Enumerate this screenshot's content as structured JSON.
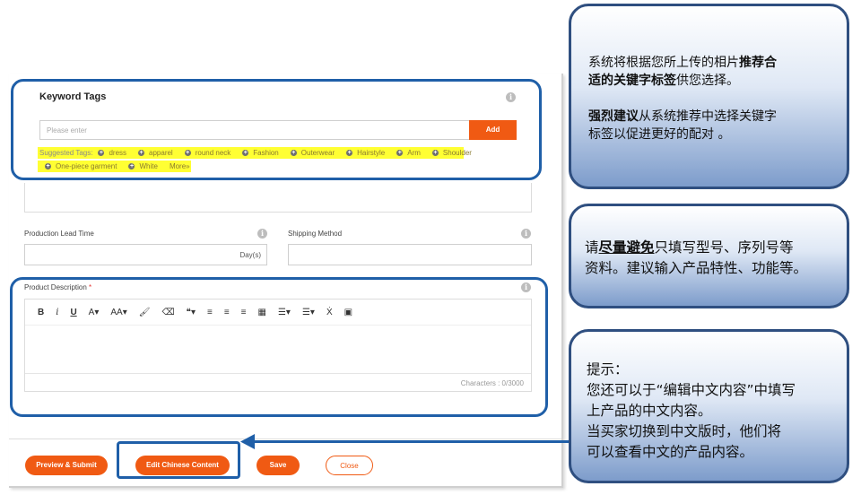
{
  "keyword_tags": {
    "title": "Keyword Tags",
    "input_placeholder": "Please enter",
    "add_label": "Add",
    "suggested_label": "Suggested Tags:",
    "tags": [
      "dress",
      "apparel",
      "round neck",
      "Fashion",
      "Outerwear",
      "Hairstyle",
      "Arm",
      "Shoulder",
      "One-piece garment",
      "White"
    ],
    "more_label": "More»"
  },
  "fields": {
    "lead_time_label": "Production Lead Time",
    "lead_time_unit": "Day(s)",
    "shipping_label": "Shipping Method"
  },
  "description": {
    "label": "Product Description",
    "required_mark": "*",
    "toolbar": [
      "B",
      "i",
      "U",
      "A▾",
      "AA▾",
      "🖌",
      "⌫",
      "❝▾",
      "≡",
      "≡",
      "≡",
      "▦",
      "☰▾",
      "☰▾",
      "Ẋ",
      "▣"
    ],
    "char_count": "Characters : 0/3000"
  },
  "buttons": {
    "preview_submit": "Preview & Submit",
    "edit_chinese": "Edit Chinese Content",
    "save": "Save",
    "close": "Close"
  },
  "callouts": {
    "c1_line1_a": "系统将根据您所上传的相片",
    "c1_line1_b": "推荐合",
    "c1_line2_a": "适的关键字标签",
    "c1_line2_b": "供您选择。",
    "c1_line3_a": "强烈建议",
    "c1_line3_b": "从系统推荐中选择关键字",
    "c1_line4": "标签以促进更好的配对 。",
    "c2_line1_a": "请",
    "c2_line1_b": "尽量避免",
    "c2_line1_c": "只填写型号、序列号等",
    "c2_line2": "资料。建议输入产品特性、功能等。",
    "c3_line1": "提示：",
    "c3_line2": "您还可以于“编辑中文内容”中填写",
    "c3_line3": "上产品的中文内容。",
    "c3_line4": "当买家切换到中文版时，他们将",
    "c3_line5": "可以查看中文的产品内容。"
  },
  "colors": {
    "accent_orange": "#f05a13",
    "highlight_blue": "#1f5fa8",
    "tag_highlight": "#ffff33"
  }
}
